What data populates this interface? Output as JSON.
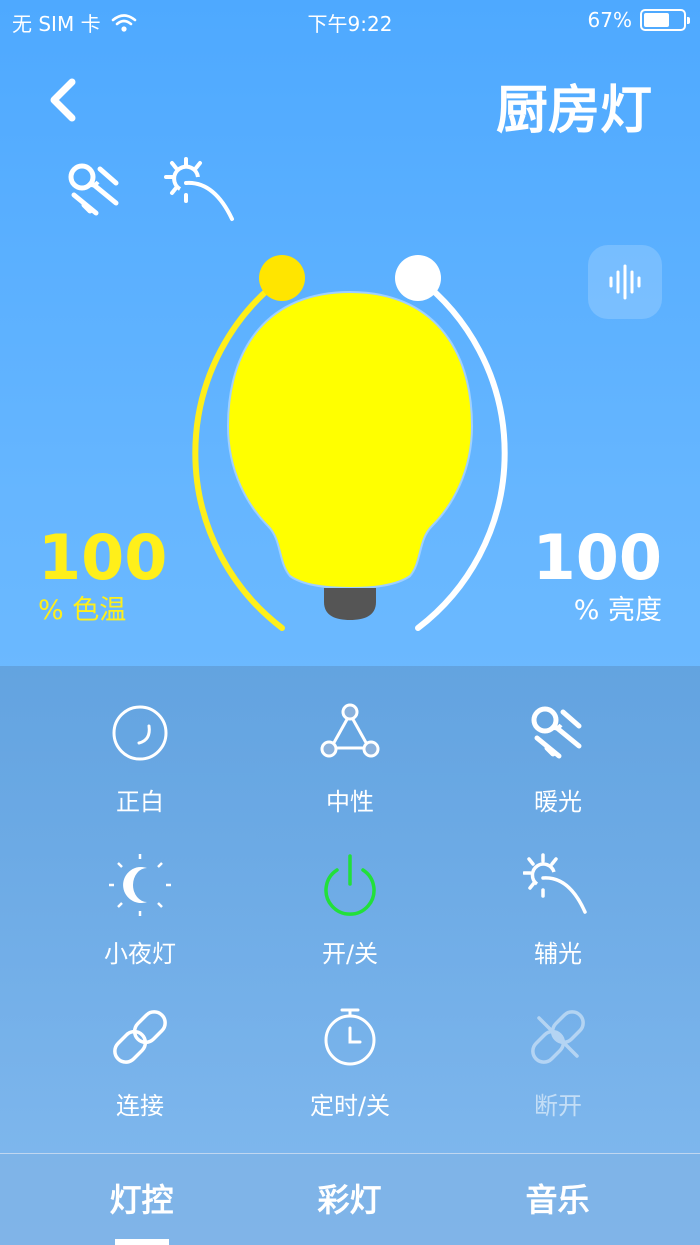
{
  "status_bar": {
    "carrier": "无 SIM 卡",
    "time": "下午9:22",
    "battery_percent": "67%",
    "battery_level": 0.67
  },
  "header": {
    "title": "厨房灯"
  },
  "icons": {
    "back": "chevron-left-icon",
    "warm_mode": "warm-light-icon",
    "aux_mode": "aux-light-icon",
    "voice": "sound-wave-icon",
    "bulb": "light-bulb-icon"
  },
  "colors": {
    "background_top": "#4ea9ff",
    "color_temp_arc": "#ffef1a",
    "brightness_arc": "#ffffff",
    "bulb": "#ffff00",
    "power_icon": "#22e03a"
  },
  "color_temperature": {
    "value": "100",
    "label": "% 色温",
    "level": 1.0
  },
  "brightness": {
    "value": "100",
    "label": "% 亮度",
    "level": 1.0
  },
  "controls": [
    {
      "label": "正白",
      "icon": "moon-circle-icon",
      "enabled": true
    },
    {
      "label": "中性",
      "icon": "triangle-nodes-icon",
      "enabled": true
    },
    {
      "label": "暖光",
      "icon": "warm-light-icon",
      "enabled": true
    },
    {
      "label": "小夜灯",
      "icon": "night-moon-icon",
      "enabled": true
    },
    {
      "label": "开/关",
      "icon": "power-icon",
      "enabled": true
    },
    {
      "label": "辅光",
      "icon": "aux-light-icon",
      "enabled": true
    },
    {
      "label": "连接",
      "icon": "link-icon",
      "enabled": true
    },
    {
      "label": "定时/关",
      "icon": "timer-icon",
      "enabled": true
    },
    {
      "label": "断开",
      "icon": "unlink-icon",
      "enabled": false
    }
  ],
  "tabs": [
    {
      "label": "灯控",
      "active": true
    },
    {
      "label": "彩灯",
      "active": false
    },
    {
      "label": "音乐",
      "active": false
    }
  ]
}
